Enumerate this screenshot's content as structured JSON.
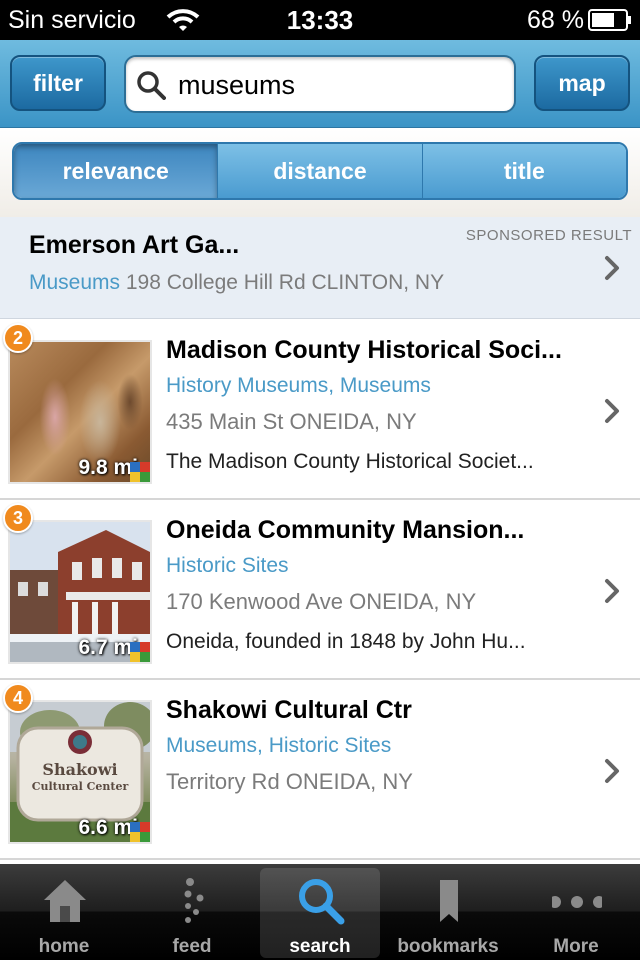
{
  "status_bar": {
    "carrier": "Sin servicio",
    "time": "13:33",
    "battery": "68 %"
  },
  "header": {
    "filter_label": "filter",
    "search_value": "museums",
    "map_label": "map"
  },
  "sort": {
    "options": [
      "relevance",
      "distance",
      "title"
    ],
    "selected": "relevance"
  },
  "sponsored": {
    "tag": "SPONSORED RESULT",
    "name": "Emerson Art Ga...",
    "category": "Museums",
    "address": "198 College Hill Rd CLINTON, NY"
  },
  "results": [
    {
      "rank": "2",
      "name": "Madison County Historical Soci...",
      "categories": "History Museums, Museums",
      "address": "435 Main St ONEIDA, NY",
      "description": "The Madison County Historical Societ...",
      "distance": "9.8 mi"
    },
    {
      "rank": "3",
      "name": "Oneida Community Mansion...",
      "categories": "Historic Sites",
      "address": "170 Kenwood Ave ONEIDA, NY",
      "description": "Oneida, founded in 1848 by John Hu...",
      "distance": "6.7 mi"
    },
    {
      "rank": "4",
      "name": "Shakowi Cultural Ctr",
      "categories": "Museums, Historic Sites",
      "address": "Territory Rd ONEIDA, NY",
      "description": "",
      "distance": "6.6 mi",
      "sign_text": [
        "Shakowi",
        "Cultural Center"
      ]
    }
  ],
  "tabs": [
    {
      "label": "home",
      "icon": "home-icon"
    },
    {
      "label": "feed",
      "icon": "feed-icon"
    },
    {
      "label": "search",
      "icon": "search-icon"
    },
    {
      "label": "bookmarks",
      "icon": "bookmark-icon"
    },
    {
      "label": "More",
      "icon": "more-icon"
    }
  ],
  "active_tab": "search",
  "colors": {
    "header_blue": "#3b94c6",
    "category_blue": "#4a9ac7",
    "rank_orange": "#f08a1e"
  }
}
